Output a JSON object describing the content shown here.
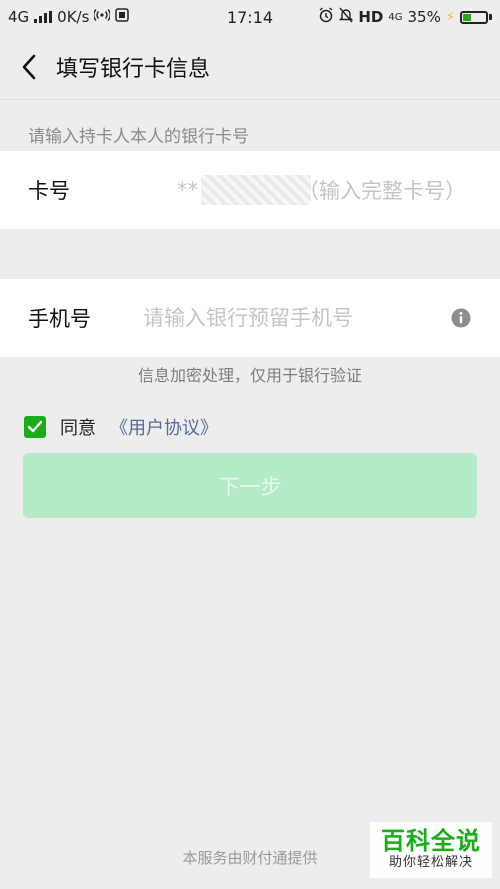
{
  "status_bar": {
    "network": "4G",
    "speed": "0K/s",
    "time": "17:14",
    "hd": "HD",
    "net4g": "4G",
    "battery_percent": "35%",
    "battery_level": 0.35
  },
  "header": {
    "title": "填写银行卡信息"
  },
  "hint": "请输入持卡人本人的银行卡号",
  "card_row": {
    "label": "卡号",
    "masked_prefix": "**",
    "placeholder_tail": "（输入完整卡号）"
  },
  "phone_row": {
    "label": "手机号",
    "placeholder": "请输入银行预留手机号"
  },
  "secure_note": "信息加密处理，仅用于银行验证",
  "agreement": {
    "checked": true,
    "label": "同意",
    "link": "《用户协议》"
  },
  "next_button": "下一步",
  "footer": "本服务由财付通提供",
  "watermark": {
    "title": "百科全说",
    "subtitle": "助你轻松解决"
  },
  "colors": {
    "accent": "#1aad19",
    "link": "#576b95",
    "button_disabled": "#b3ebc8"
  }
}
